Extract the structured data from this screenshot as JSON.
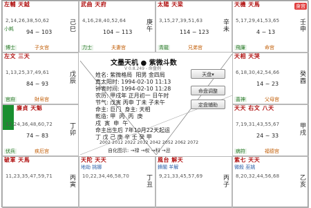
{
  "app": {
    "title": "文墨天机 ● 紫微斗数",
    "version": "V 0.8.249 - 命盘例"
  },
  "info": {
    "name": "姓名: 紫微格局  阳男 金四局",
    "real_time": "真太阳时: 1994-02-10 11:13",
    "clock_time": "钟表时间: 1994-02-10 11:28",
    "lunar": "农历: 甲戌年 正月初一 日午时",
    "meta": "节气: 戊寅 丙申 丁未 子未午",
    "life": "命主: 巨门  身主: 天相",
    "pillars": "乾造: 甲  丙  丙  庚",
    "pillars2": "戌  寅  申  午",
    "start": "命主出生后 7年10月22天起运",
    "dayun": "丁 戊 己 庚 辛 壬 癸 甲"
  },
  "years": "2002 2012 2022 2032 2042 2052 2062 2072",
  "legend": "自化图示: →禄 →权 →科 →忌",
  "buttons": {
    "shanpan": "天盘▾",
    "adjust": "命盘调整",
    "correction": "定盘辅助"
  },
  "cells": [
    {
      "stars": "左輔 天鉞",
      "sub": "小耗",
      "nums": "2,14,26,38,50,62",
      "range": "94 ~ 103",
      "side_top": "小耗",
      "side_bot": "",
      "palace": "子女宫",
      "tag": "博士",
      "stem": "己巳"
    },
    {
      "stars": "武曲 天府",
      "sub": "將星",
      "nums": "4,16,28,40,52,64",
      "range": "104 ~ 113",
      "side_top": "",
      "side_bot": "",
      "palace": "夫妻宫",
      "tag": "力士",
      "stem": "庚午"
    },
    {
      "stars": "太陽 天梁",
      "sub": "攀鞍",
      "nums": "3,15,27,39,51,63",
      "range": "114 ~ 123",
      "side_top": "",
      "side_bot": "",
      "palace": "兄弟宫",
      "tag": "青龍",
      "stem": "辛未"
    },
    {
      "stars": "天機 天馬",
      "sub": "飛廉",
      "nums": "5,17,29,41,53,65",
      "range": "4 ~ 13",
      "side_top": "",
      "side_bot": "",
      "palace": "命宫",
      "tag": "飛廉",
      "stem": "壬申",
      "stamp": "身宫"
    },
    {
      "stars": "左文 三天",
      "sub": "祿存",
      "nums": "1,13,25,37,49,61",
      "range": "84 ~ 93",
      "side_top": "",
      "side_bot": "",
      "palace": "財帛宫",
      "tag": "官府",
      "stem": "戊辰"
    },
    {
      "stars": "天相 天哭",
      "sub": "天月",
      "nums": "6,18,30,42,54,66",
      "range": "14 ~ 23",
      "side_top": "",
      "side_bot": "",
      "palace": "父母宫",
      "tag": "喜神",
      "stem": "癸酉"
    },
    {
      "stars": "廉貞 天魁",
      "sub": "天巫",
      "nums": "12,24,36,48,60,72",
      "range": "74 ~ 83",
      "side_top": "",
      "side_bot": "",
      "palace": "疾厄宫",
      "tag": "伏兵",
      "stem": "丁卯"
    },
    {
      "stars": "天天 右文 八天",
      "sub": "龍德",
      "nums": "7,19,31,43,55,67",
      "range": "24 ~ 33",
      "side_top": "",
      "side_bot": "",
      "palace": "福德宫",
      "tag": "病符",
      "stem": "甲戌"
    },
    {
      "stars": "破軍 天馬",
      "sub": "",
      "nums": "11,23,35,47,59,71",
      "range": "",
      "side_top": "",
      "side_bot": "",
      "palace": "",
      "tag": "",
      "stem": "丙寅"
    },
    {
      "stars": "天陀 天天",
      "sub": "地劫 挑娜",
      "nums": "10,22,34,46,58,70",
      "range": "",
      "side_top": "",
      "side_bot": "",
      "palace": "",
      "tag": "",
      "stem": "丁丑"
    },
    {
      "stars": "風台 解天",
      "sub": "鋒閣 羊解",
      "nums": "9,21,33,45,57,69",
      "range": "",
      "side_top": "",
      "side_bot": "",
      "palace": "",
      "tag": "",
      "stem": "丙子"
    },
    {
      "stars": "紫七 天天",
      "sub": "微殺 巫姚",
      "nums": "8,20,32,44,56,68",
      "range": "",
      "side_top": "",
      "side_bot": "",
      "palace": "",
      "tag": "",
      "stem": "乙亥"
    }
  ]
}
